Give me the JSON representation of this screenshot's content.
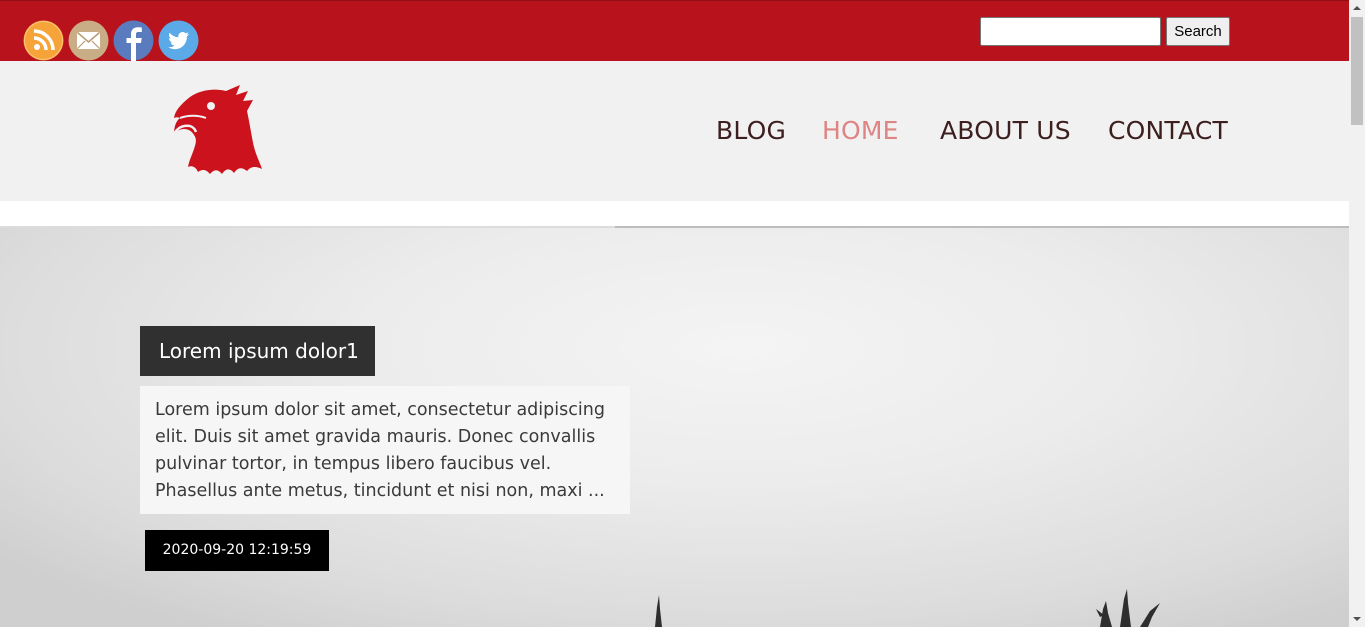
{
  "social": {
    "icons": [
      "rss-icon",
      "mail-icon",
      "facebook-icon",
      "twitter-icon"
    ],
    "colors": {
      "rss": "#f6a43a",
      "mail": "#c8ad86",
      "facebook": "#5b7bbf",
      "twitter": "#5ba9e6"
    }
  },
  "search": {
    "value": "",
    "placeholder": "",
    "button_label": "Search"
  },
  "logo": {
    "icon": "eagle-head-icon",
    "color": "#cc121c"
  },
  "nav": {
    "items": [
      {
        "label": "BLOG",
        "active": false
      },
      {
        "label": "HOME",
        "active": true
      },
      {
        "label": "ABOUT US",
        "active": false
      },
      {
        "label": "CONTACT",
        "active": false
      }
    ]
  },
  "post": {
    "title": "Lorem ipsum dolor1",
    "excerpt": "Lorem ipsum dolor sit amet, consectetur adipiscing elit. Duis sit amet gravida mauris. Donec convallis pulvinar tortor, in tempus libero faucibus vel. Phasellus ante metus, tincidunt et nisi non, maxi ...",
    "date": "2020-09-20 12:19:59"
  },
  "colors": {
    "topbar": "#b8121c",
    "header_bg": "#f2f1f1",
    "nav_text": "#3d1f1f",
    "nav_active": "#de8484",
    "title_bg": "#303030",
    "date_bg": "#000000"
  }
}
